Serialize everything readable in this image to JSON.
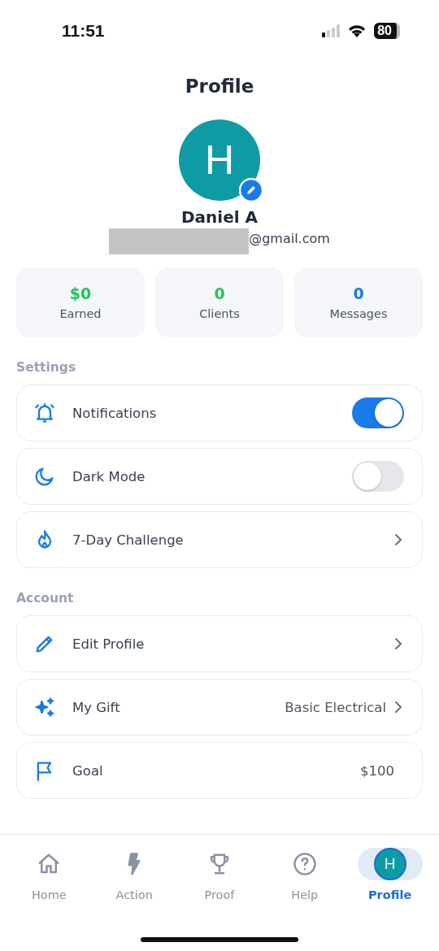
{
  "status_bar": {
    "time": "11:51",
    "battery": "80"
  },
  "header": {
    "title": "Profile"
  },
  "profile": {
    "initial": "H",
    "name": "Daniel A",
    "email_visible": "@gmail.com"
  },
  "stats": [
    {
      "value": "$0",
      "label": "Earned",
      "color": "#22c55e"
    },
    {
      "value": "0",
      "label": "Clients",
      "color": "#22c55e"
    },
    {
      "value": "0",
      "label": "Messages",
      "color": "#1a7be8"
    }
  ],
  "sections": [
    {
      "title": "Settings",
      "rows": [
        {
          "kind": "toggle",
          "label": "Notifications",
          "on": true
        },
        {
          "kind": "toggle",
          "label": "Dark Mode",
          "on": false
        },
        {
          "kind": "link",
          "label": "7-Day Challenge"
        }
      ]
    },
    {
      "title": "Account",
      "rows": [
        {
          "kind": "link",
          "label": "Edit Profile"
        },
        {
          "kind": "link",
          "label": "My Gift",
          "value": "Basic Electrical"
        },
        {
          "kind": "value",
          "label": "Goal",
          "value": "$100"
        }
      ]
    }
  ],
  "nav": [
    {
      "label": "Home",
      "selected": false
    },
    {
      "label": "Action",
      "selected": false
    },
    {
      "label": "Proof",
      "selected": false
    },
    {
      "label": "Help",
      "selected": false
    },
    {
      "label": "Profile",
      "initial": "H",
      "selected": true
    }
  ]
}
